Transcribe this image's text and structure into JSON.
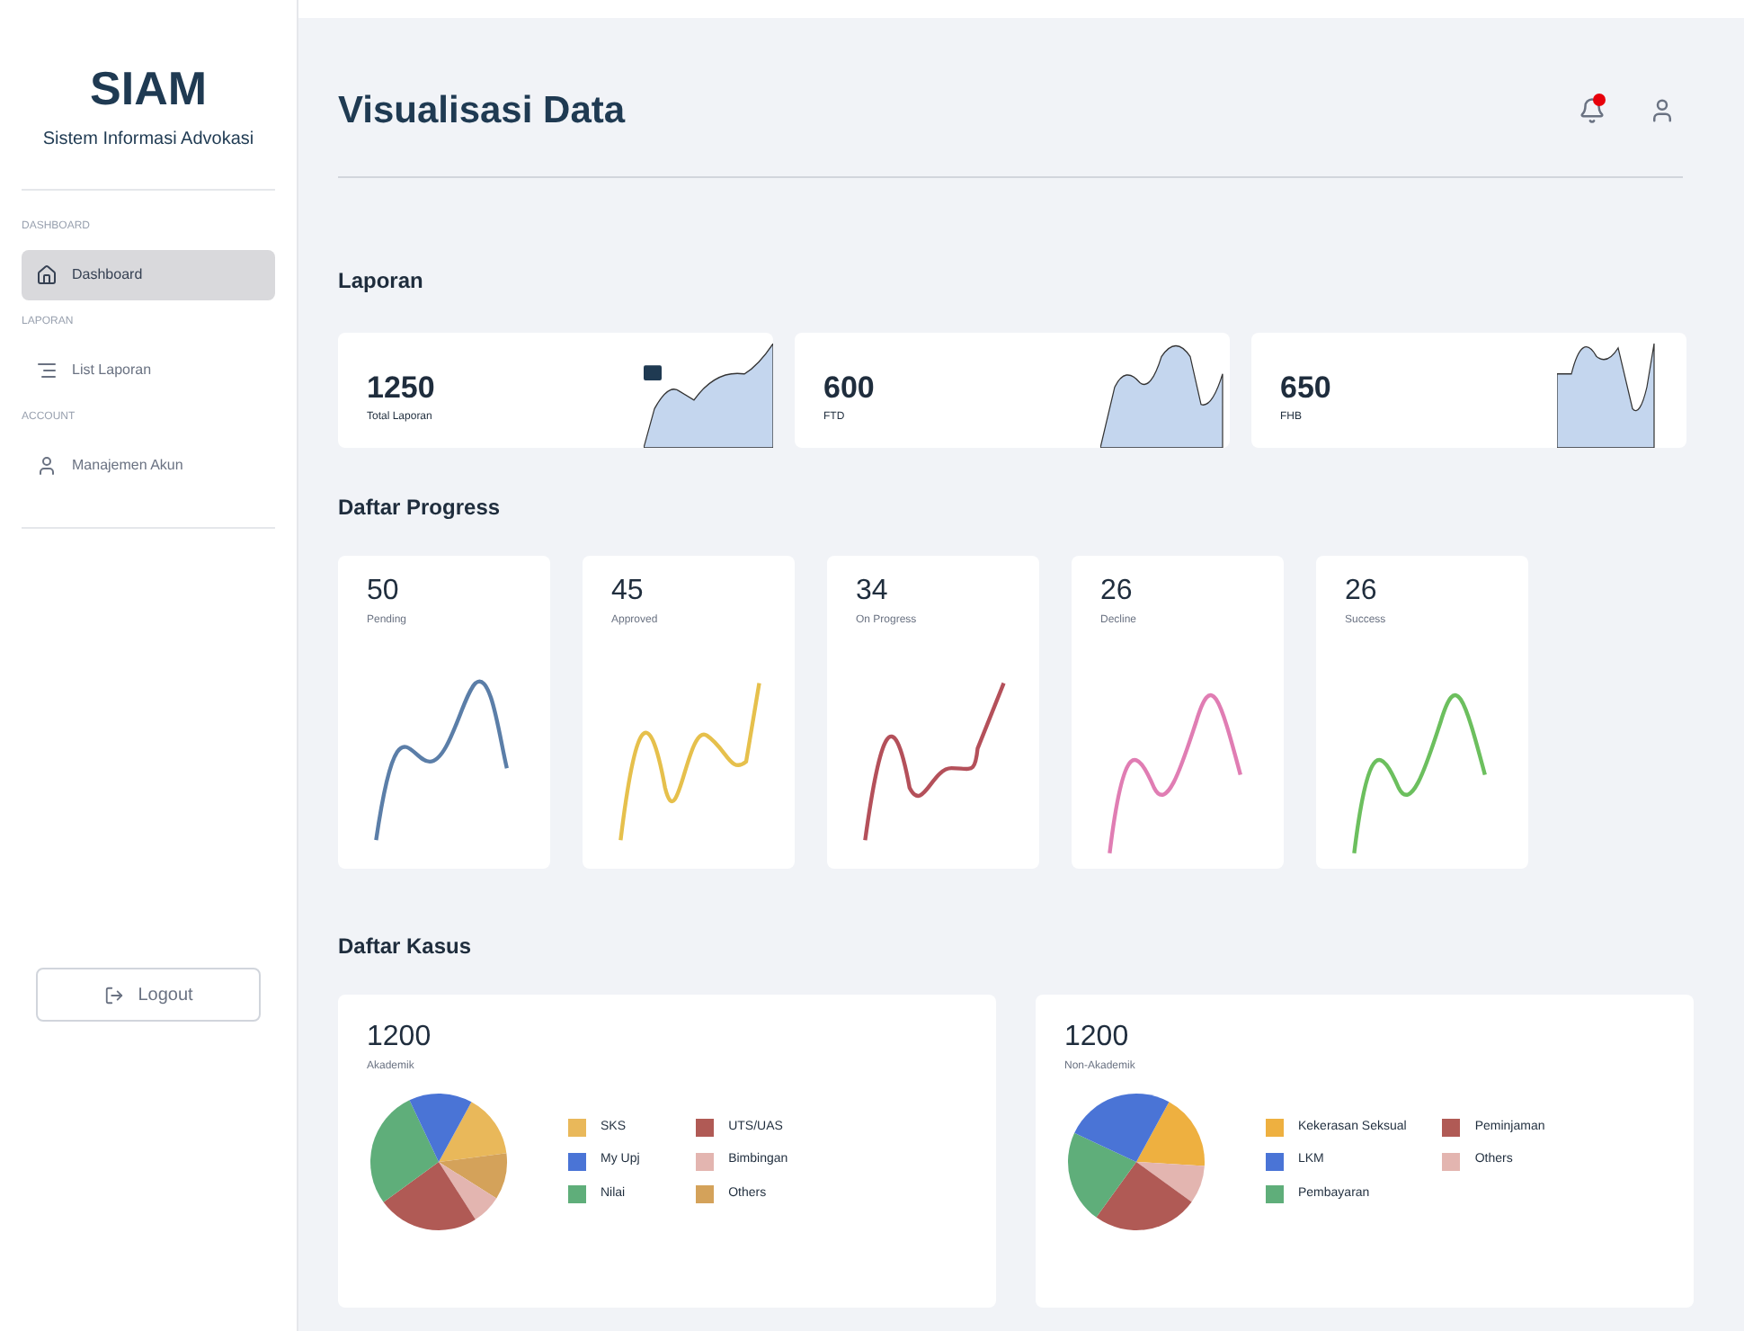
{
  "sidebar": {
    "logo": "SIAM",
    "subtitle": "Sistem Informasi Advokasi",
    "sections": [
      {
        "heading": "DASHBOARD",
        "items": [
          {
            "label": "Dashboard",
            "selected": true
          }
        ]
      },
      {
        "heading": "LAPORAN",
        "items": [
          {
            "label": "List Laporan",
            "selected": false
          }
        ]
      },
      {
        "heading": "ACCOUNT",
        "items": [
          {
            "label": "Manajemen Akun",
            "selected": false
          }
        ]
      }
    ],
    "logout": "Logout"
  },
  "header": {
    "title": "Visualisasi Data",
    "notification": true
  },
  "laporan": {
    "title": "Laporan",
    "cards": [
      {
        "value": "1250",
        "label": "Total Laporan"
      },
      {
        "value": "600",
        "label": "FTD"
      },
      {
        "value": "650",
        "label": "FHB"
      }
    ]
  },
  "progress": {
    "title": "Daftar Progress",
    "cards": [
      {
        "value": "50",
        "label": "Pending",
        "color": "#5b7ea8"
      },
      {
        "value": "45",
        "label": "Approved",
        "color": "#e6c04c"
      },
      {
        "value": "34",
        "label": "On Progress",
        "color": "#b4505a"
      },
      {
        "value": "26",
        "label": "Decline",
        "color": "#e07db3"
      },
      {
        "value": "26",
        "label": "Success",
        "color": "#6cbf5e"
      }
    ]
  },
  "kasus": {
    "title": "Daftar Kasus",
    "cards": [
      {
        "value": "1200",
        "label": "Akademik",
        "legend": [
          {
            "label": "SKS",
            "color": "#e9b85a"
          },
          {
            "label": "UTS/UAS",
            "color": "#b05a55"
          },
          {
            "label": "My Upj",
            "color": "#4a74d6"
          },
          {
            "label": "Bimbingan",
            "color": "#e3b5b0"
          },
          {
            "label": "Nilai",
            "color": "#5fae7a"
          },
          {
            "label": "Others",
            "color": "#d4a25a"
          }
        ]
      },
      {
        "value": "1200",
        "label": "Non-Akademik",
        "legend": [
          {
            "label": "Kekerasan Seksual",
            "color": "#eeb040"
          },
          {
            "label": "Peminjaman",
            "color": "#b05a55"
          },
          {
            "label": "LKM",
            "color": "#4a74d6"
          },
          {
            "label": "Others",
            "color": "#e3b5b0"
          },
          {
            "label": "Pembayaran",
            "color": "#5fae7a"
          }
        ]
      }
    ]
  }
}
